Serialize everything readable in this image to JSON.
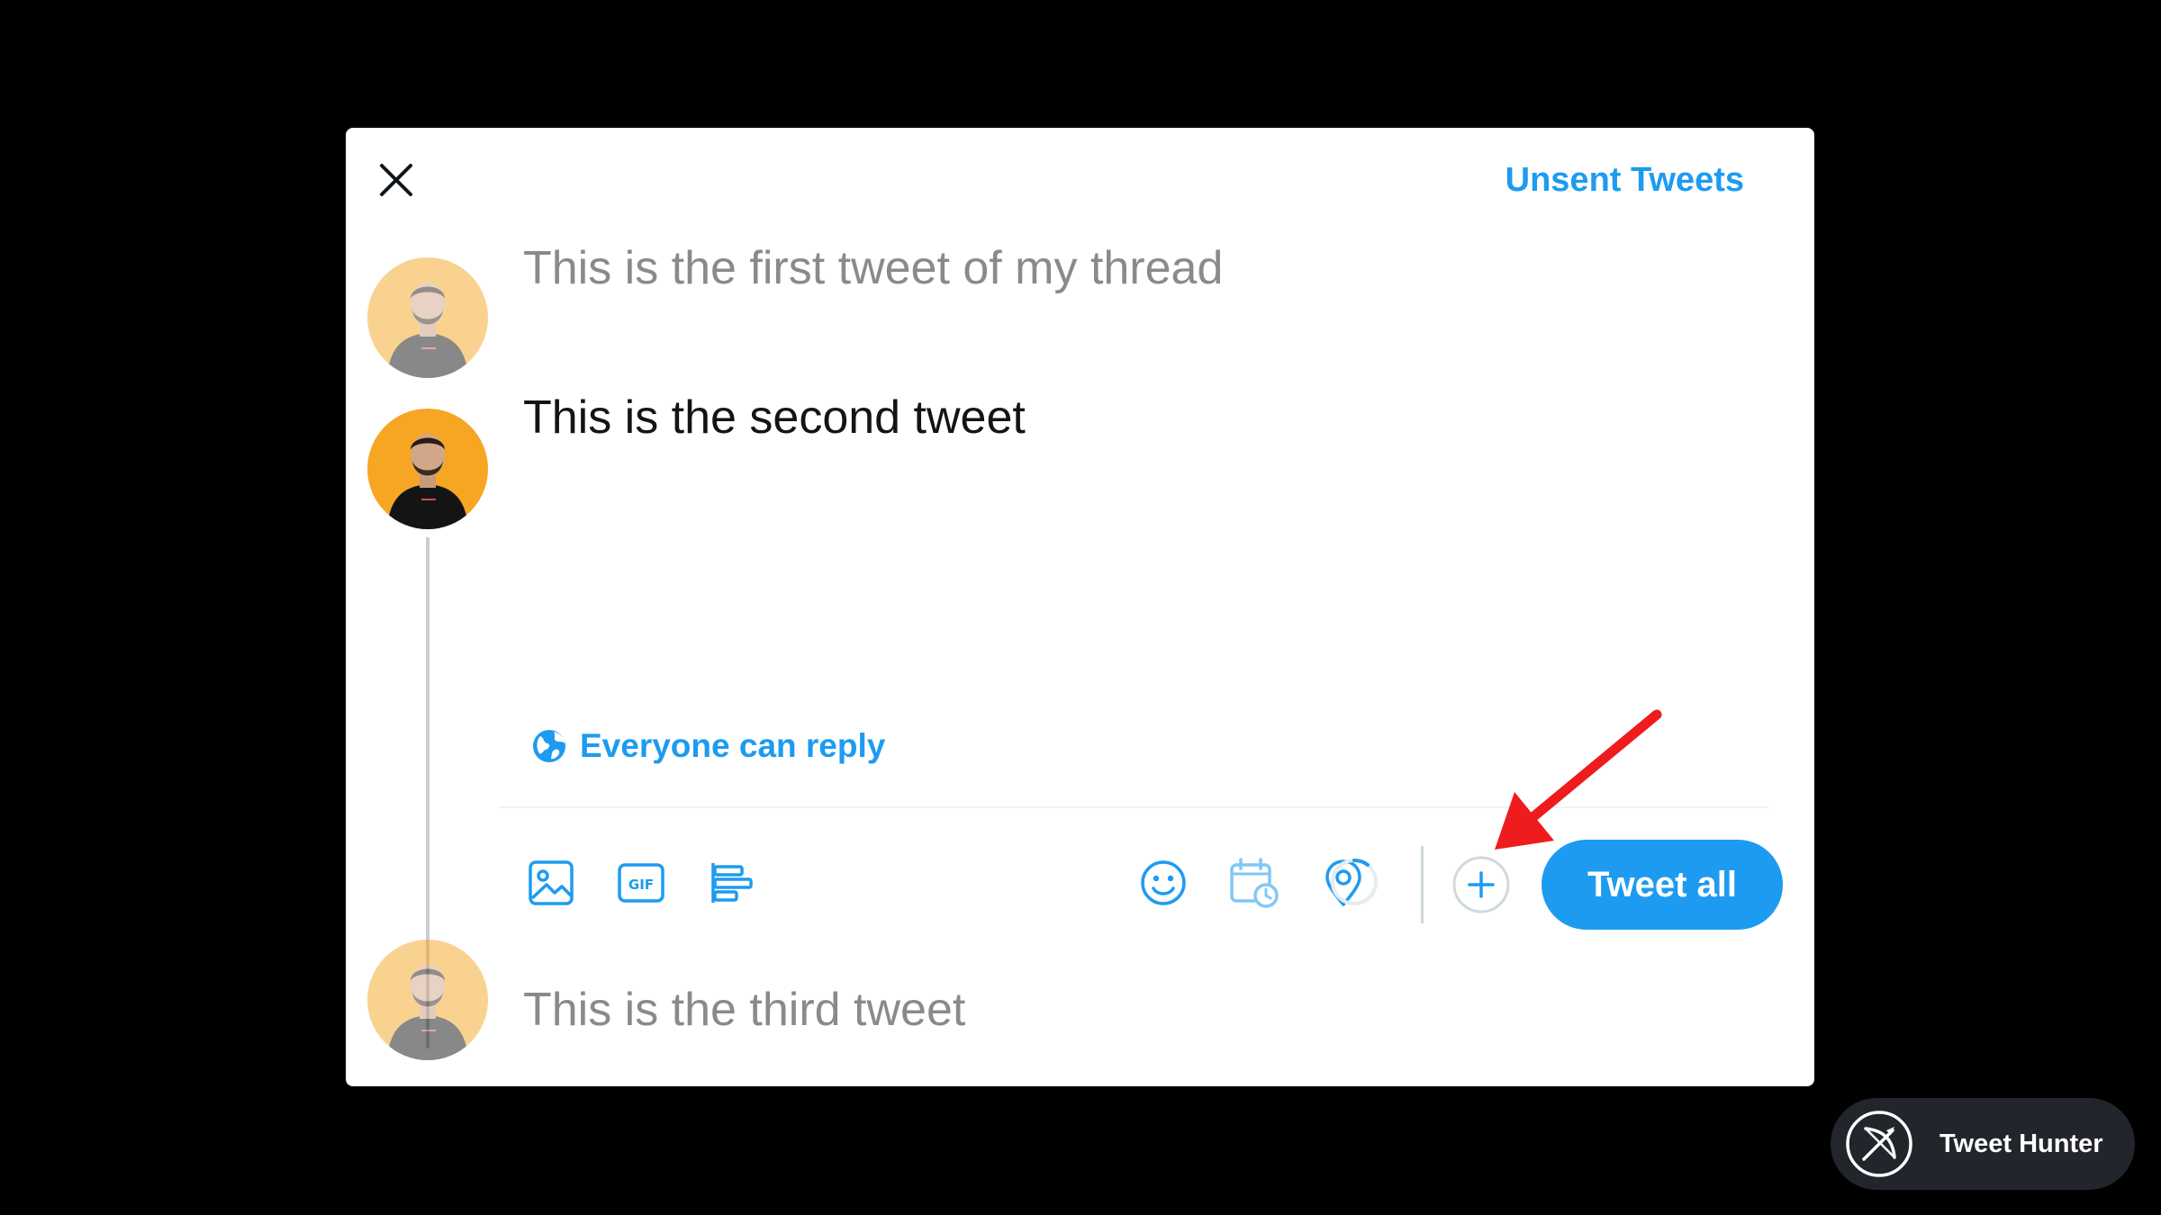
{
  "dialog": {
    "unsent_label": "Unsent Tweets"
  },
  "thread": {
    "tweets": [
      {
        "text": "This is the first tweet of my thread",
        "state": "placeholder"
      },
      {
        "text": "This is the second tweet",
        "state": "active"
      },
      {
        "text": "This is the third tweet",
        "state": "placeholder"
      }
    ]
  },
  "composer": {
    "reply_setting": "Everyone can reply",
    "toolbar_icons": [
      "image-icon",
      "gif-icon",
      "poll-icon",
      "emoji-icon",
      "schedule-icon",
      "location-icon"
    ],
    "submit_label": "Tweet all"
  },
  "watermark": {
    "label": "Tweet Hunter"
  },
  "colors": {
    "accent": "#1d9bf0",
    "annotation_arrow": "#ee1c1c",
    "avatar_bg": "#f6a623",
    "overlay": "#000000"
  }
}
